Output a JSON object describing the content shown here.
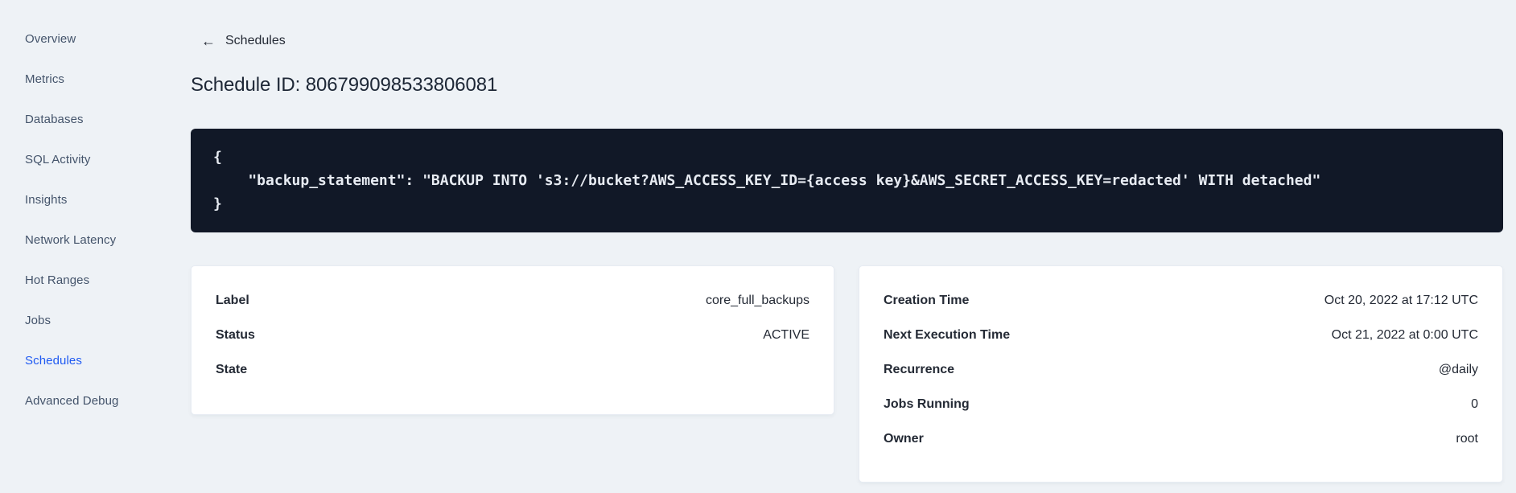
{
  "sidebar": {
    "items": [
      {
        "label": "Overview",
        "active": false
      },
      {
        "label": "Metrics",
        "active": false
      },
      {
        "label": "Databases",
        "active": false
      },
      {
        "label": "SQL Activity",
        "active": false
      },
      {
        "label": "Insights",
        "active": false
      },
      {
        "label": "Network Latency",
        "active": false
      },
      {
        "label": "Hot Ranges",
        "active": false
      },
      {
        "label": "Jobs",
        "active": false
      },
      {
        "label": "Schedules",
        "active": true
      },
      {
        "label": "Advanced Debug",
        "active": false
      }
    ]
  },
  "header": {
    "back_arrow": "←",
    "back_label": "Schedules",
    "title": "Schedule ID: 806799098533806081"
  },
  "code_block": {
    "lines": [
      "{",
      "    \"backup_statement\": \"BACKUP INTO 's3://bucket?AWS_ACCESS_KEY_ID={access key}&AWS_SECRET_ACCESS_KEY=redacted' WITH detached\"",
      "}"
    ]
  },
  "summary_card": {
    "rows": [
      {
        "label": "Label",
        "value": "core_full_backups"
      },
      {
        "label": "Status",
        "value": "ACTIVE"
      },
      {
        "label": "State",
        "value": ""
      }
    ]
  },
  "details_card": {
    "rows": [
      {
        "label": "Creation Time",
        "value": "Oct 20, 2022 at 17:12 UTC"
      },
      {
        "label": "Next Execution Time",
        "value": "Oct 21, 2022 at 0:00 UTC"
      },
      {
        "label": "Recurrence",
        "value": "@daily"
      },
      {
        "label": "Jobs Running",
        "value": "0"
      },
      {
        "label": "Owner",
        "value": "root"
      }
    ]
  },
  "colors": {
    "accent_blue": "#1f5af2",
    "code_background": "#111827",
    "page_background": "#eef2f6"
  }
}
